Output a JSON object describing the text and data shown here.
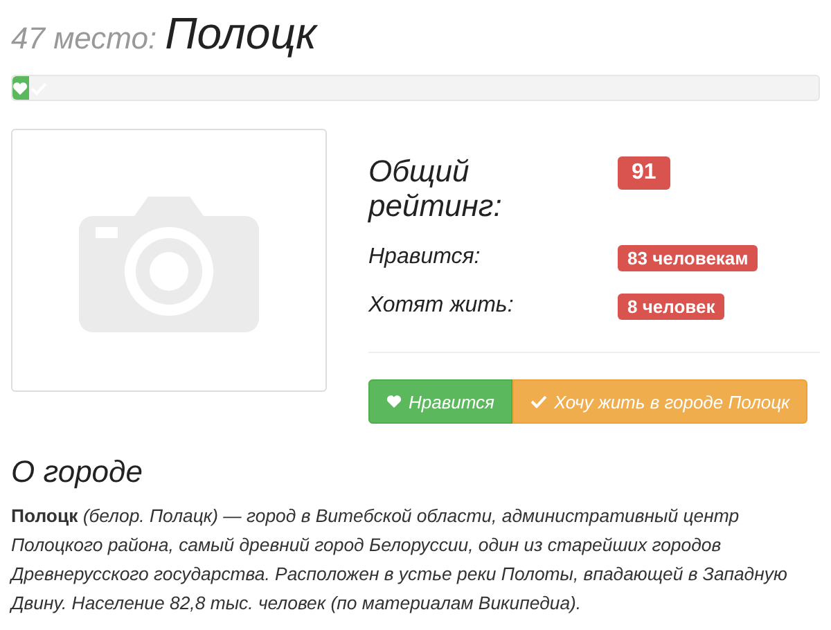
{
  "header": {
    "rank": "47 место:",
    "city": "Полоцк"
  },
  "progress": {
    "level": 0.02
  },
  "photo": {
    "kind": "placeholder"
  },
  "stats": [
    {
      "label": "Общий рейтинг:",
      "value": "91",
      "kind": "rating"
    },
    {
      "label": "Нравится:",
      "value": "83 человекам",
      "kind": "count"
    },
    {
      "label": "Хотят жить:",
      "value": "8 человек",
      "kind": "count"
    }
  ],
  "buttons": [
    {
      "label": "Нравится",
      "kind": "like"
    },
    {
      "label": "Хочу жить в городе Полоцк",
      "kind": "live"
    }
  ],
  "about": {
    "title": "О городе",
    "text": "**Полоцк** (белор. Полацк) — город в Витебской области, административный центр Полоцкого района, самый древний город Белоруссии, один из старейших городов Древнерусского государства. Расположен в устье реки Полоты, впадающей в Западную Двину. Население 82,8 тыс. человек (по материалам Википедиа)."
  }
}
